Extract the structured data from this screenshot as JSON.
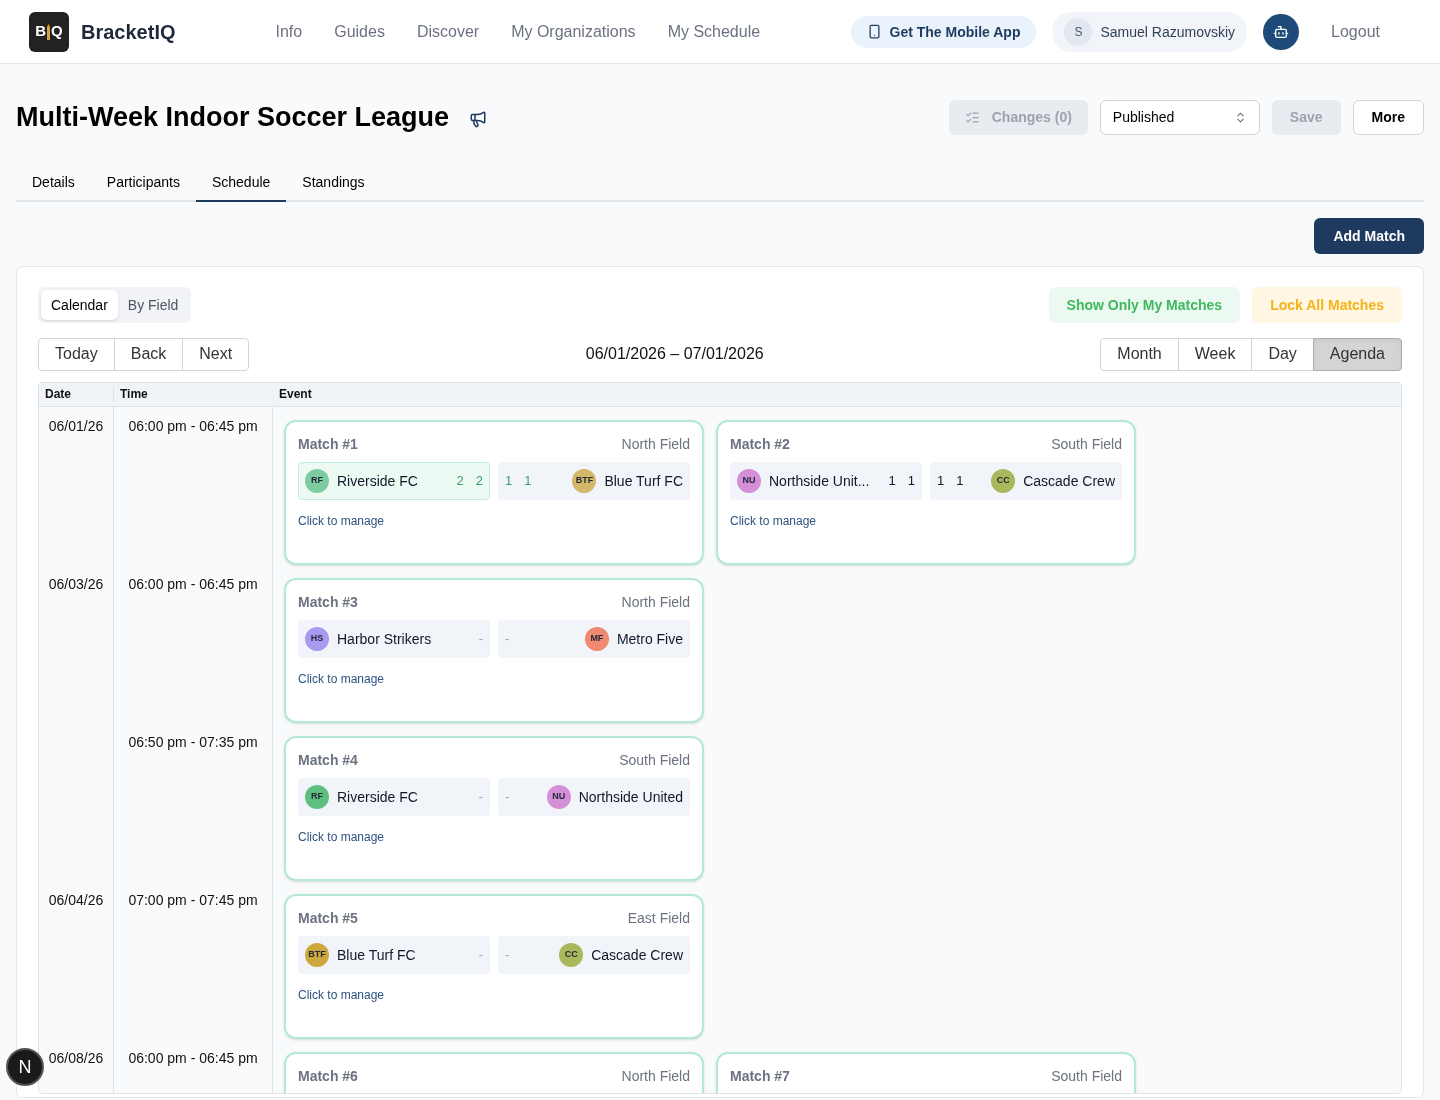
{
  "brand": {
    "logo_letters": [
      "B",
      "Q"
    ],
    "name": "BracketIQ"
  },
  "nav": [
    {
      "label": "Info"
    },
    {
      "label": "Guides"
    },
    {
      "label": "Discover"
    },
    {
      "label": "My Organizations"
    },
    {
      "label": "My Schedule"
    }
  ],
  "header_actions": {
    "mobile_app": "Get The Mobile App",
    "user": {
      "initial": "S",
      "name": "Samuel Razumovskiy"
    },
    "logout": "Logout"
  },
  "page": {
    "title": "Multi-Week Indoor Soccer League",
    "changes": {
      "label": "Changes (0)",
      "disabled": true
    },
    "status": "Published",
    "save": {
      "label": "Save",
      "disabled": true
    },
    "more": "More"
  },
  "tabs": [
    {
      "label": "Details",
      "selected": false
    },
    {
      "label": "Participants",
      "selected": false
    },
    {
      "label": "Schedule",
      "selected": true
    },
    {
      "label": "Standings",
      "selected": false
    }
  ],
  "add_match": "Add Match",
  "view_toggle": [
    {
      "label": "Calendar",
      "selected": true
    },
    {
      "label": "By Field",
      "selected": false
    }
  ],
  "filters": {
    "show_mine": "Show Only My Matches",
    "lock_all": "Lock All Matches"
  },
  "nav_buttons": [
    "Today",
    "Back",
    "Next"
  ],
  "range": "06/01/2026 – 07/01/2026",
  "views": [
    {
      "label": "Month",
      "selected": false
    },
    {
      "label": "Week",
      "selected": false
    },
    {
      "label": "Day",
      "selected": false
    },
    {
      "label": "Agenda",
      "selected": true
    }
  ],
  "table": {
    "columns": [
      "Date",
      "Time",
      "Event"
    ],
    "rows": [
      {
        "date": "06/01/26",
        "slots": [
          {
            "time": "06:00 pm - 06:45 pm",
            "matches": [
              {
                "title": "Match #1",
                "field": "North Field",
                "kind": "final",
                "manage": "Click to manage",
                "teams": [
                  {
                    "name": "Riverside FC",
                    "initials": "RF",
                    "color": "#7ecba1",
                    "winner": true,
                    "scores": [
                      "2",
                      "2"
                    ]
                  },
                  {
                    "name": "Blue Turf FC",
                    "initials": "BTF",
                    "color": "#d4b76a",
                    "winner": false,
                    "scores": [
                      "1",
                      "1"
                    ]
                  }
                ]
              },
              {
                "title": "Match #2",
                "field": "South Field",
                "kind": "in_progress",
                "manage": "Click to manage",
                "teams": [
                  {
                    "name": "Northside Unit...",
                    "initials": "NU",
                    "color": "#d48fd6",
                    "winner": false,
                    "scores": [
                      "1",
                      "1"
                    ]
                  },
                  {
                    "name": "Cascade Crew",
                    "initials": "CC",
                    "color": "#a8b85a",
                    "winner": false,
                    "scores": [
                      "1",
                      "1"
                    ]
                  }
                ]
              }
            ]
          }
        ]
      },
      {
        "date": "06/03/26",
        "slots": [
          {
            "time": "06:00 pm - 06:45 pm",
            "matches": [
              {
                "title": "Match #3",
                "field": "North Field",
                "kind": "scheduled",
                "manage": "Click to manage",
                "teams": [
                  {
                    "name": "Harbor Strikers",
                    "initials": "HS",
                    "color": "#a99af0",
                    "winner": false,
                    "scores": [
                      "-"
                    ]
                  },
                  {
                    "name": "Metro Five",
                    "initials": "MF",
                    "color": "#ef8a70",
                    "winner": false,
                    "scores": [
                      "-"
                    ]
                  }
                ]
              }
            ]
          },
          {
            "time": "06:50 pm - 07:35 pm",
            "matches": [
              {
                "title": "Match #4",
                "field": "South Field",
                "kind": "scheduled",
                "manage": "Click to manage",
                "teams": [
                  {
                    "name": "Riverside FC",
                    "initials": "RF",
                    "color": "#5fbf80",
                    "winner": false,
                    "scores": [
                      "-"
                    ]
                  },
                  {
                    "name": "Northside United",
                    "initials": "NU",
                    "color": "#d48fd6",
                    "winner": false,
                    "scores": [
                      "-"
                    ]
                  }
                ]
              }
            ]
          }
        ]
      },
      {
        "date": "06/04/26",
        "slots": [
          {
            "time": "07:00 pm - 07:45 pm",
            "matches": [
              {
                "title": "Match #5",
                "field": "East Field",
                "kind": "scheduled",
                "manage": "Click to manage",
                "teams": [
                  {
                    "name": "Blue Turf FC",
                    "initials": "BTF",
                    "color": "#cda83e",
                    "winner": false,
                    "scores": [
                      "-"
                    ]
                  },
                  {
                    "name": "Cascade Crew",
                    "initials": "CC",
                    "color": "#a8b85a",
                    "winner": false,
                    "scores": [
                      "-"
                    ]
                  }
                ]
              }
            ]
          }
        ]
      },
      {
        "date": "06/08/26",
        "slots": [
          {
            "time": "06:00 pm - 06:45 pm",
            "matches": [
              {
                "title": "Match #6",
                "field": "North Field"
              },
              {
                "title": "Match #7",
                "field": "South Field"
              }
            ]
          }
        ]
      }
    ]
  },
  "floating_badge": "N"
}
